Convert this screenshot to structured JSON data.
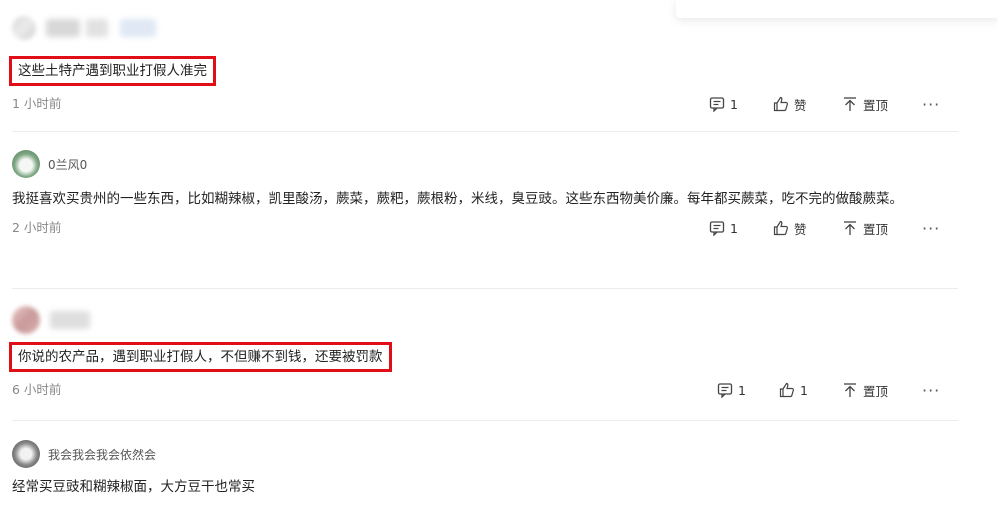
{
  "comments": [
    {
      "user": "",
      "text": "这些土特产遇到职业打假人准完",
      "time": "1 小时前",
      "reply_count": "1",
      "like_label": "赞",
      "pin_label": "置顶",
      "more": "···"
    },
    {
      "user": "0兰风0",
      "text": "我挺喜欢买贵州的一些东西，比如糊辣椒，凯里酸汤，蕨菜，蕨粑，蕨根粉，米线，臭豆豉。这些东西物美价廉。每年都买蕨菜，吃不完的做酸蕨菜。",
      "time": "2 小时前",
      "reply_count": "1",
      "like_label": "赞",
      "pin_label": "置顶",
      "more": "···"
    },
    {
      "user": "",
      "text": "你说的农产品，遇到职业打假人，不但赚不到钱，还要被罚款",
      "time": "6 小时前",
      "reply_count": "1",
      "like_label": "1",
      "pin_label": "置顶",
      "more": "···"
    },
    {
      "user": "我会我会我会依然会",
      "text": "经常买豆豉和糊辣椒面，大方豆干也常买"
    }
  ]
}
